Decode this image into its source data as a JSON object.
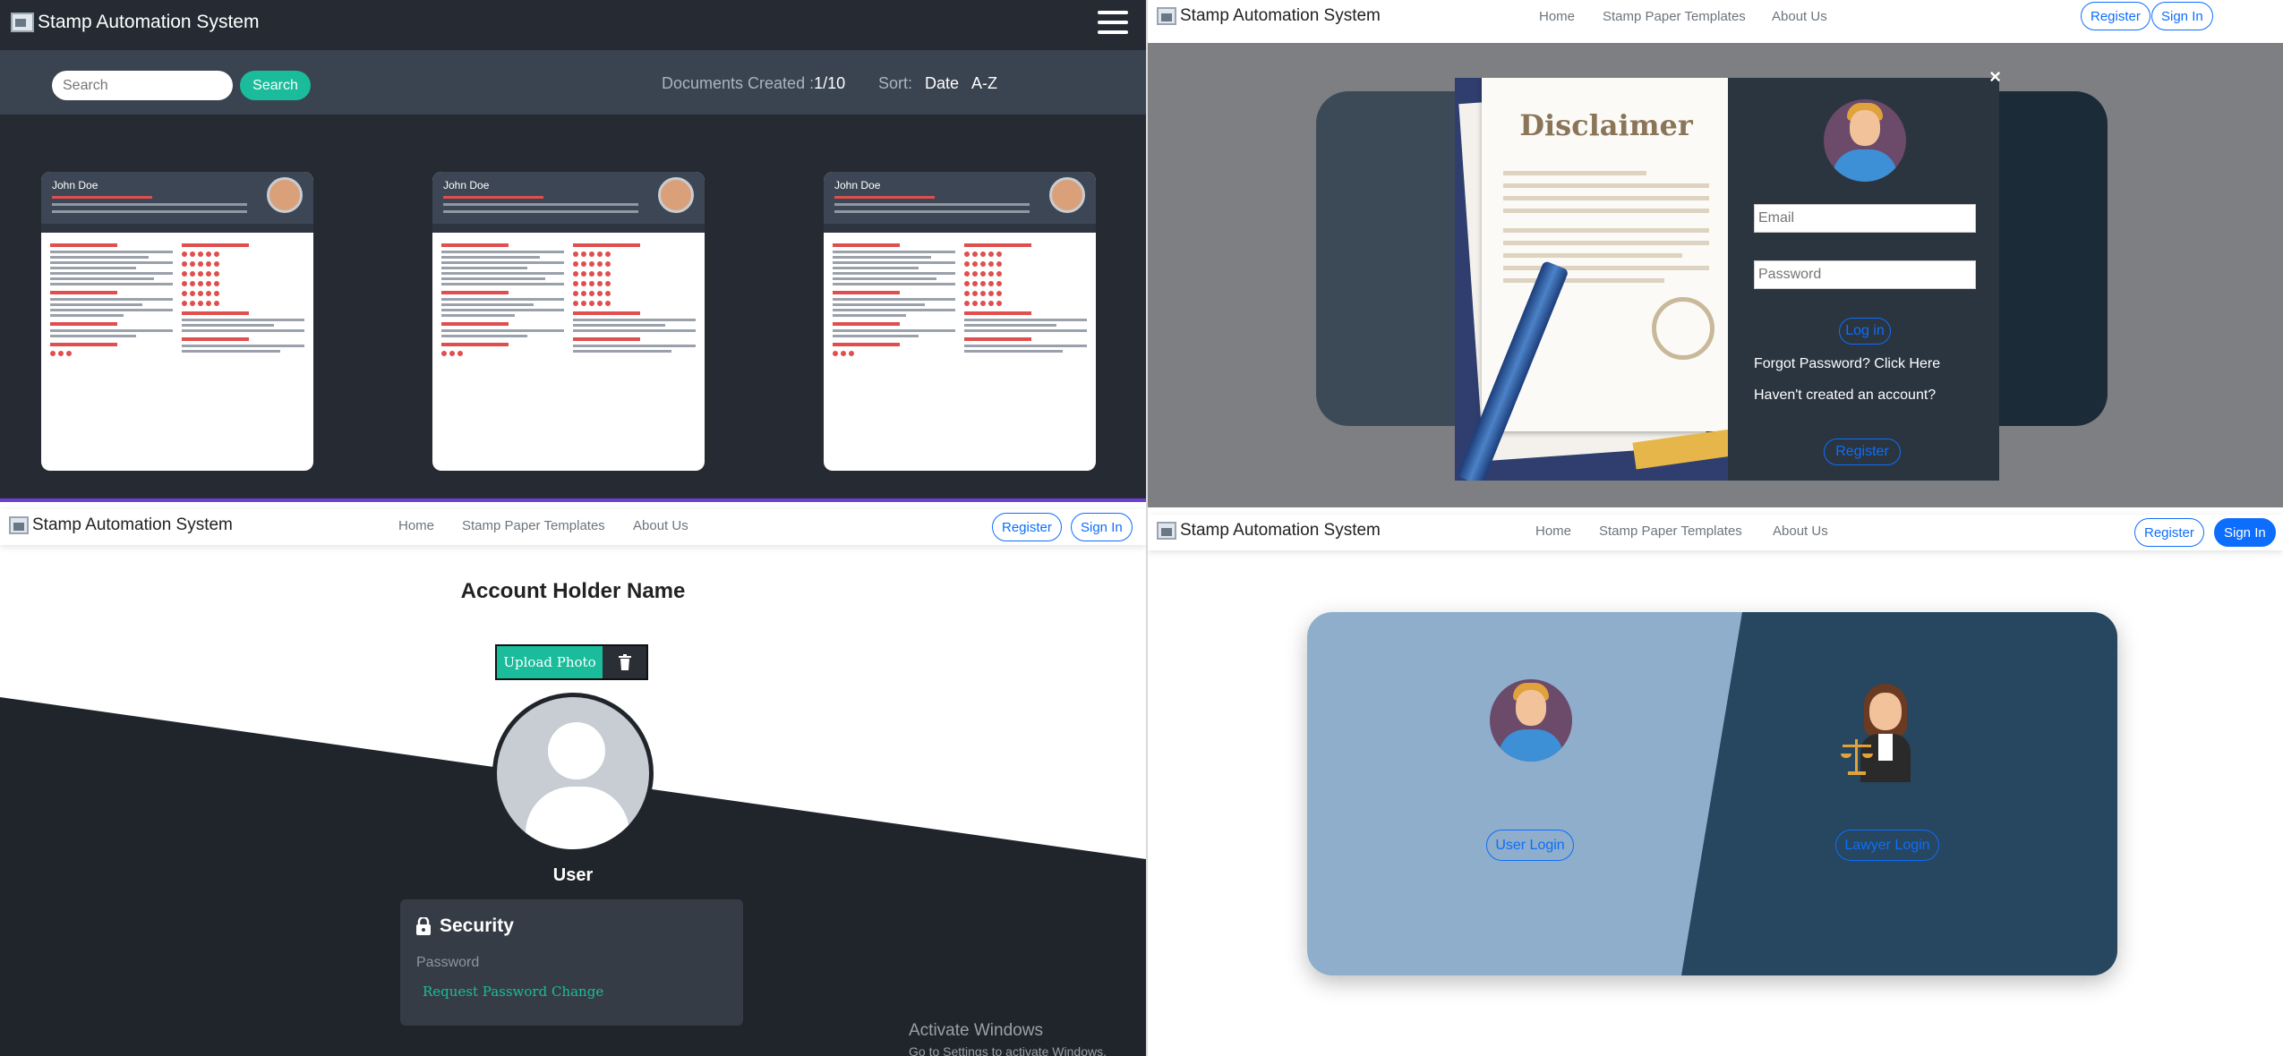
{
  "brand": "Stamp Automation System",
  "nav": {
    "home": "Home",
    "templates": "Stamp Paper Templates",
    "about": "About Us",
    "register": "Register",
    "signin": "Sign In"
  },
  "q1": {
    "search_placeholder": "Search",
    "search_button": "Search",
    "docs_label": "Documents Created :",
    "docs_value": "1/10",
    "sort_label": "Sort:",
    "sort_options": [
      "Date",
      "A-Z"
    ],
    "resumes": [
      {
        "name": "John Doe"
      },
      {
        "name": "John Doe"
      },
      {
        "name": "John Doe"
      }
    ]
  },
  "q2": {
    "disclaimer": "Disclaimer",
    "close": "×",
    "email_placeholder": "Email",
    "password_placeholder": "Password",
    "login": "Log in",
    "forgot": "Forgot Password?",
    "click_here": "Click Here",
    "no_account": "Haven't created an account?",
    "register": "Register"
  },
  "q3": {
    "account_holder": "Account Holder Name",
    "upload": "Upload Photo",
    "user": "User",
    "security_title": "Security",
    "password_label": "Password",
    "request_change": "Request Password Change",
    "activate_title": "Activate Windows",
    "activate_sub": "Go to Settings to activate Windows."
  },
  "q4": {
    "user_login": "User Login",
    "lawyer_login": "Lawyer Login"
  },
  "colors": {
    "accent_teal": "#1abc9c",
    "primary_blue": "#0d6efd",
    "dark_bg": "#262b33"
  },
  "icons": [
    "hamburger-icon",
    "lock-icon",
    "trash-icon",
    "close-icon"
  ]
}
